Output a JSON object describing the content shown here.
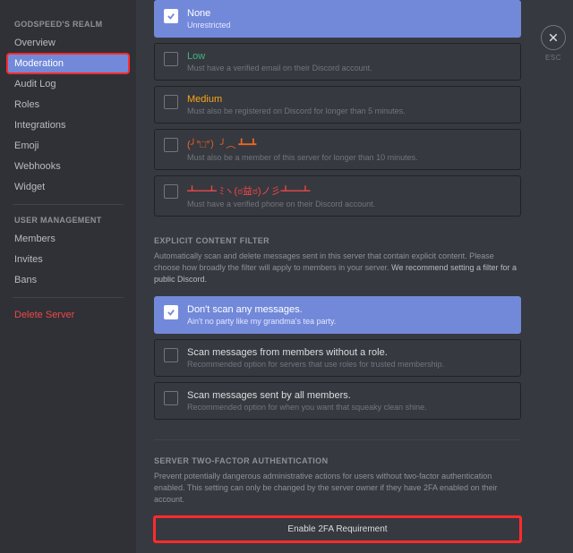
{
  "sidebar": {
    "server_heading": "GODSPEED'S REALM",
    "items": [
      {
        "label": "Overview"
      },
      {
        "label": "Moderation"
      },
      {
        "label": "Audit Log"
      },
      {
        "label": "Roles"
      },
      {
        "label": "Integrations"
      },
      {
        "label": "Emoji"
      },
      {
        "label": "Webhooks"
      },
      {
        "label": "Widget"
      }
    ],
    "user_heading": "USER MANAGEMENT",
    "user_items": [
      {
        "label": "Members"
      },
      {
        "label": "Invites"
      },
      {
        "label": "Bans"
      }
    ],
    "delete_label": "Delete Server"
  },
  "close": {
    "esc": "ESC"
  },
  "verification": {
    "options": [
      {
        "title": "None",
        "sub": "Unrestricted"
      },
      {
        "title": "Low",
        "sub": "Must have a verified email on their Discord account."
      },
      {
        "title": "Medium",
        "sub": "Must also be registered on Discord for longer than 5 minutes."
      },
      {
        "title": "(╯°□°）╯︵ ┻━┻",
        "sub": "Must also be a member of this server for longer than 10 minutes."
      },
      {
        "title": "┻━┻ ﾐヽ(ಠ益ಠ)ノ彡┻━┻",
        "sub": "Must have a verified phone on their Discord account."
      }
    ]
  },
  "explicit": {
    "heading": "EXPLICIT CONTENT FILTER",
    "desc1": "Automatically scan and delete messages sent in this server that contain explicit content. Please choose how broadly the filter will apply to members in your server. ",
    "desc2": "We recommend setting a filter for a public Discord.",
    "options": [
      {
        "title": "Don't scan any messages.",
        "sub": "Ain't no party like my grandma's tea party."
      },
      {
        "title": "Scan messages from members without a role.",
        "sub": "Recommended option for servers that use roles for trusted membership."
      },
      {
        "title": "Scan messages sent by all members.",
        "sub": "Recommended option for when you want that squeaky clean shine."
      }
    ]
  },
  "twofa": {
    "heading": "SERVER TWO-FACTOR AUTHENTICATION",
    "desc": "Prevent potentially dangerous administrative actions for users without two-factor authentication enabled. This setting can only be changed by the server owner if they have 2FA enabled on their account.",
    "button": "Enable 2FA Requirement"
  }
}
